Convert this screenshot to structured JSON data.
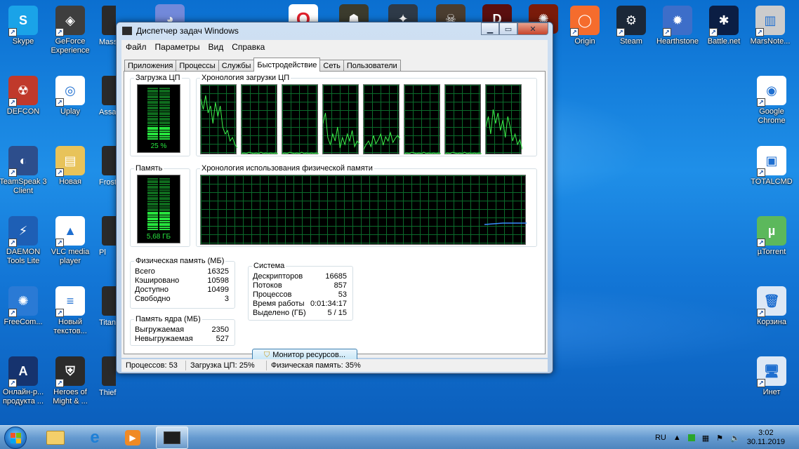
{
  "desktop": {
    "left_icons": [
      {
        "label": "Skype",
        "color": "#1aa3e8",
        "glyph": "S"
      },
      {
        "label": "GeForce Experience",
        "color": "#3e3e3e",
        "glyph": "◈"
      },
      {
        "label": "DEFCON",
        "color": "#c0392b",
        "glyph": "☢"
      },
      {
        "label": "Uplay",
        "color": "#ffffff",
        "glyph": "◎"
      },
      {
        "label": "TeamSpeak 3 Client",
        "color": "#2d4e8c",
        "glyph": "◐"
      },
      {
        "label": "Новая",
        "color": "#e8c35a",
        "glyph": "▤"
      },
      {
        "label": "DAEMON Tools Lite",
        "color": "#1e5fb5",
        "glyph": "⚡"
      },
      {
        "label": "VLC media player",
        "color": "#ffffff",
        "glyph": "▲"
      },
      {
        "label": "FreeCom...",
        "color": "#2a7ad5",
        "glyph": "✺"
      },
      {
        "label": "Новый текстов...",
        "color": "#ffffff",
        "glyph": "≡"
      },
      {
        "label": "Онлайн-р... продукта ...",
        "color": "#16336e",
        "glyph": "A"
      },
      {
        "label": "Heroes of Might & ...",
        "color": "#2b2b2b",
        "glyph": "⛨"
      }
    ],
    "partial_icons": [
      "Mass Andro",
      "Assa Cree",
      "Frost",
      "Pl",
      "Titan",
      "Thief"
    ],
    "right_icons": [
      {
        "label": "Origin",
        "color": "#f56c2d",
        "glyph": "◯"
      },
      {
        "label": "Steam",
        "color": "#1b2838",
        "glyph": "⚙"
      },
      {
        "label": "Hearthstone",
        "color": "#3d6ec9",
        "glyph": "✹"
      },
      {
        "label": "Battle.net",
        "color": "#0b1e44",
        "glyph": "✱"
      },
      {
        "label": "MarsNote...",
        "color": "#cccccc",
        "glyph": "▥"
      },
      {
        "label": "Google Chrome",
        "color": "#ffffff",
        "glyph": "◉"
      },
      {
        "label": "TOTALCMD",
        "color": "#ffffff",
        "glyph": "▣"
      },
      {
        "label": "µTorrent",
        "color": "#5cb85c",
        "glyph": "µ"
      },
      {
        "label": "Корзина",
        "color": "#dde8f5",
        "glyph": "🗑"
      },
      {
        "label": "Инет",
        "color": "#dde8f5",
        "glyph": "🖥"
      }
    ]
  },
  "window": {
    "title": "Диспетчер задач Windows",
    "menu": [
      "Файл",
      "Параметры",
      "Вид",
      "Справка"
    ],
    "tabs": [
      "Приложения",
      "Процессы",
      "Службы",
      "Быстродействие",
      "Сеть",
      "Пользователи"
    ],
    "selected_tab": "Быстродействие",
    "cpu_group_title": "Загрузка ЦП",
    "cpu_value": "25 %",
    "cpu_level": 0.25,
    "cpu_history_title": "Хронология загрузки ЦП",
    "mem_group_title": "Память",
    "mem_value": "5,68 ГБ",
    "mem_level": 0.35,
    "mem_history_title": "Хронология использования физической памяти",
    "phys": {
      "title": "Физическая память (МБ)",
      "rows": [
        {
          "k": "Всего",
          "v": "16325"
        },
        {
          "k": "Кэшировано",
          "v": "10598"
        },
        {
          "k": "Доступно",
          "v": "10499"
        },
        {
          "k": "Свободно",
          "v": "3"
        }
      ]
    },
    "kernel": {
      "title": "Память ядра (МБ)",
      "rows": [
        {
          "k": "Выгружаемая",
          "v": "2350"
        },
        {
          "k": "Невыгружаемая",
          "v": "527"
        }
      ]
    },
    "system": {
      "title": "Система",
      "rows": [
        {
          "k": "Дескрипторов",
          "v": "16685"
        },
        {
          "k": "Потоков",
          "v": "857"
        },
        {
          "k": "Процессов",
          "v": "53"
        },
        {
          "k": "Время работы",
          "v": "0:01:34:17"
        },
        {
          "k": "Выделено (ГБ)",
          "v": "5 / 15"
        }
      ]
    },
    "resource_monitor_button": "Монитор ресурсов...",
    "status": {
      "processes": "Процессов: 53",
      "cpu": "Загрузка ЦП: 25%",
      "mem": "Физическая память: 35%"
    }
  },
  "tray": {
    "lang": "RU",
    "time": "3:02",
    "date": "30.11.2019"
  }
}
